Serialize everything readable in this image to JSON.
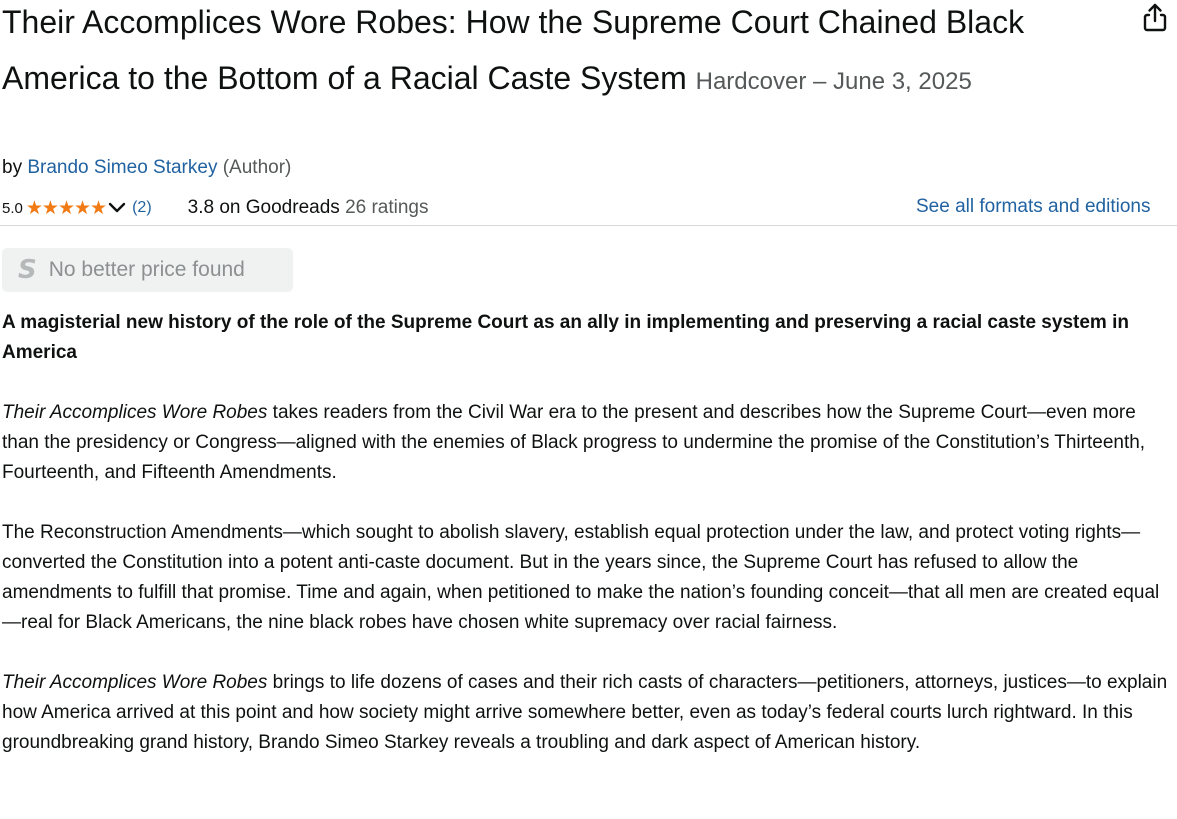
{
  "product": {
    "title": "Their Accomplices Wore Robes: How the Supreme Court Chained Black America to the Bottom of a Racial Caste System",
    "format_date": "Hardcover – June 3, 2025"
  },
  "byline": {
    "prefix": "by",
    "author": "Brando Simeo Starkey",
    "role": "(Author)"
  },
  "ratings": {
    "average": "5.0",
    "stars_filled": 5,
    "stars_total": 5,
    "count": "(2)",
    "goodreads_score": "3.8 on Goodreads",
    "goodreads_count": "26 ratings",
    "star_color": "#f37b16"
  },
  "formats_link": "See all formats and editions",
  "price_badge": {
    "icon": "S",
    "label": "No better price found"
  },
  "description": {
    "headline": "A magisterial new history of the role of the Supreme Court as an ally in implementing and preserving a racial caste system in America",
    "p1_title": "Their Accomplices Wore Robes",
    "p1_text": " takes readers from the Civil War era to the present and describes how the Supreme Court—even more than the presidency or Congress—aligned with the enemies of Black progress to undermine the promise of the Constitution’s Thirteenth, Fourteenth, and Fifteenth Amendments.",
    "p2_text": "The Reconstruction Amendments—which sought to abolish slavery, establish equal protection under the law, and protect voting rights—converted the Constitution into a potent anti-caste document. But in the years since, the Supreme Court has refused to allow the amendments to fulfill that promise. Time and again, when petitioned to make the nation’s founding conceit—that all men are created equal—real for Black Americans, the nine black robes have chosen white supremacy over racial fairness.",
    "p3_title": "Their Accomplices Wore Robes",
    "p3_text": " brings to life dozens of cases and their rich casts of characters—petitioners, attorneys, justices—to explain how America arrived at this point and how society might arrive somewhere better, even as today’s federal courts lurch rightward. In this groundbreaking grand history, Brando Simeo Starkey reveals a troubling and dark aspect of American history."
  },
  "colors": {
    "link": "#2162a1",
    "muted": "#565959",
    "badge_bg": "#f0f2f2"
  },
  "icons": {
    "share": "share-icon",
    "stars": "star-icon",
    "dropdown": "chevron-down-icon",
    "price": "s-logo-icon"
  }
}
